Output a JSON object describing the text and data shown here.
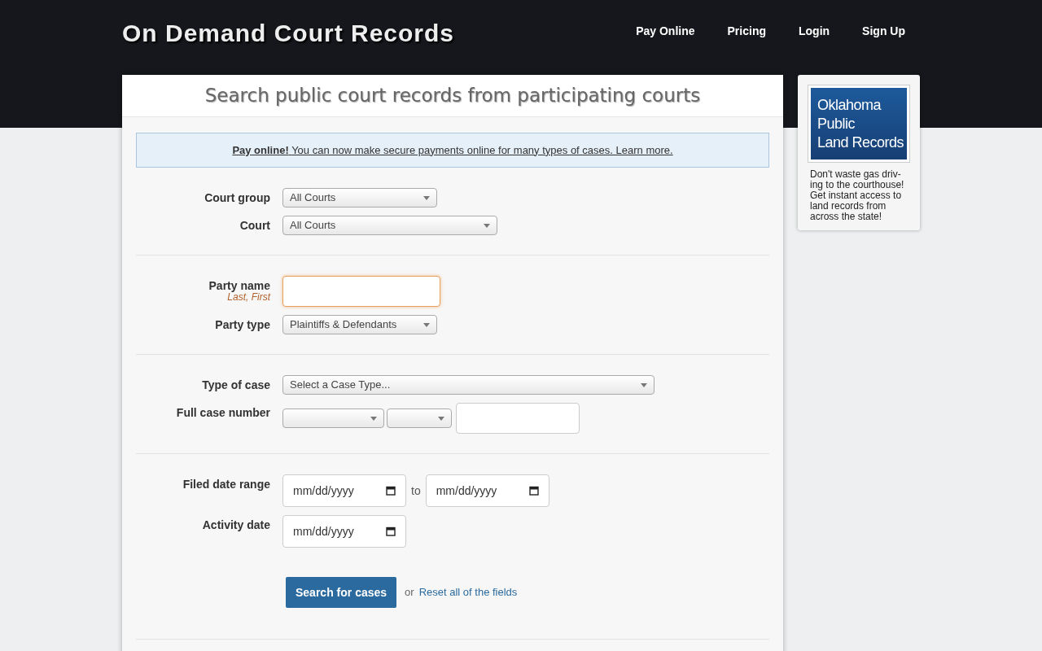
{
  "site": {
    "title": "On Demand Court Records"
  },
  "nav": [
    "Pay Online",
    "Pricing",
    "Login",
    "Sign Up"
  ],
  "heading": "Search public court records from participating courts",
  "notice": {
    "lead": "Pay online!",
    "text": "You can now make secure payments online for many types of cases. Learn more."
  },
  "sections": [
    {
      "fields": [
        {
          "kind": "select",
          "label": "Court group",
          "value": "All Courts"
        },
        {
          "kind": "select",
          "label": "Court",
          "value": "All Courts"
        }
      ]
    },
    {
      "fields": [
        {
          "kind": "text",
          "label": "Party name",
          "hint": "Last, First",
          "focused": true
        },
        {
          "kind": "select",
          "label": "Party type",
          "value": "Plaintiffs & Defendants"
        }
      ]
    },
    {
      "fields": [
        {
          "kind": "select",
          "label": "Type of case",
          "value": "Select a Case Type..."
        },
        {
          "kind": "case_number",
          "label": "Full case number"
        }
      ]
    },
    {
      "fields": [
        {
          "kind": "date_range",
          "label": "Filed date range",
          "from": "mm/dd/yyyy",
          "joiner": "to",
          "to": "mm/dd/yyyy"
        },
        {
          "kind": "date",
          "label": "Activity date",
          "value": "mm/dd/yyyy"
        }
      ]
    }
  ],
  "actions": {
    "submit": "Search for cases",
    "separator": "or",
    "reset": "Reset all of the fields"
  },
  "ad": {
    "banner_lines": [
      "Oklahoma",
      "Public",
      "Land Records"
    ],
    "text": "Don't waste gas driv-ing to the courthouse! Get instant access to land records from across the state!"
  }
}
